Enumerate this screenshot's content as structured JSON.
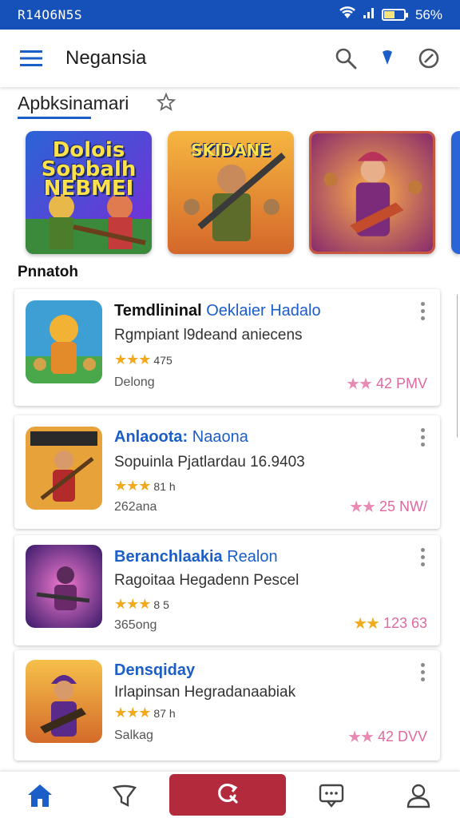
{
  "status_bar": {
    "carrier": "R14O6N5S",
    "battery": "56%",
    "battery_level": 0.56
  },
  "app_bar": {
    "title": "Negansia",
    "menu_icon": "menu-icon",
    "search_icon": "search-icon",
    "pin_icon": "pin-icon",
    "block_icon": "block-icon"
  },
  "featured": {
    "title": "Apbksinamari",
    "items": [
      {
        "overlay_text": "Dolois Sopbalh NEBMEI",
        "label": "featured-1"
      },
      {
        "overlay_text": "SKIDANE",
        "label": "featured-2"
      },
      {
        "overlay_text": "",
        "label": "featured-3"
      }
    ]
  },
  "list": {
    "title": "Pnnatoh",
    "apps": [
      {
        "name": "Temdlininal",
        "name_rest": " Oeklaier Hadalo",
        "desc": "Rgmpiant l9deand aniecens",
        "rating": "★★★",
        "rating_text": "475",
        "meta": "Delong",
        "price_stars": "★★",
        "price": "42 PMV"
      },
      {
        "name": "Anlaoota:",
        "name_rest": " Naaona",
        "desc": "Sopuinla Pjatlardau 16.9403",
        "rating": "★★★",
        "rating_text": "81 h",
        "meta": "262ana",
        "price_stars": "★★",
        "price": "25 NW/"
      },
      {
        "name": "Beranchlaakia",
        "name_rest": " Realon",
        "desc": "Ragoitaa Hegadenn Pescel",
        "rating": "★★★",
        "rating_text": "8 5",
        "meta": "365ong",
        "price_stars": "★★",
        "price": "123 63"
      },
      {
        "name": "Densqiday",
        "name_rest": "",
        "desc": "Irlapinsan Hegradanaabiak",
        "rating": "★★★",
        "rating_text": "87 h",
        "meta": "Salkag",
        "price_stars": "★★",
        "price": "42 DVV"
      }
    ]
  },
  "bottom_nav": {
    "items": [
      "home-icon",
      "filter-icon",
      "refresh-search-icon",
      "chat-icon",
      "profile-icon"
    ]
  },
  "colors": {
    "primary": "#1551b8",
    "accent": "#b22a3c",
    "price": "#e06aa0",
    "star": "#f1a91d"
  }
}
